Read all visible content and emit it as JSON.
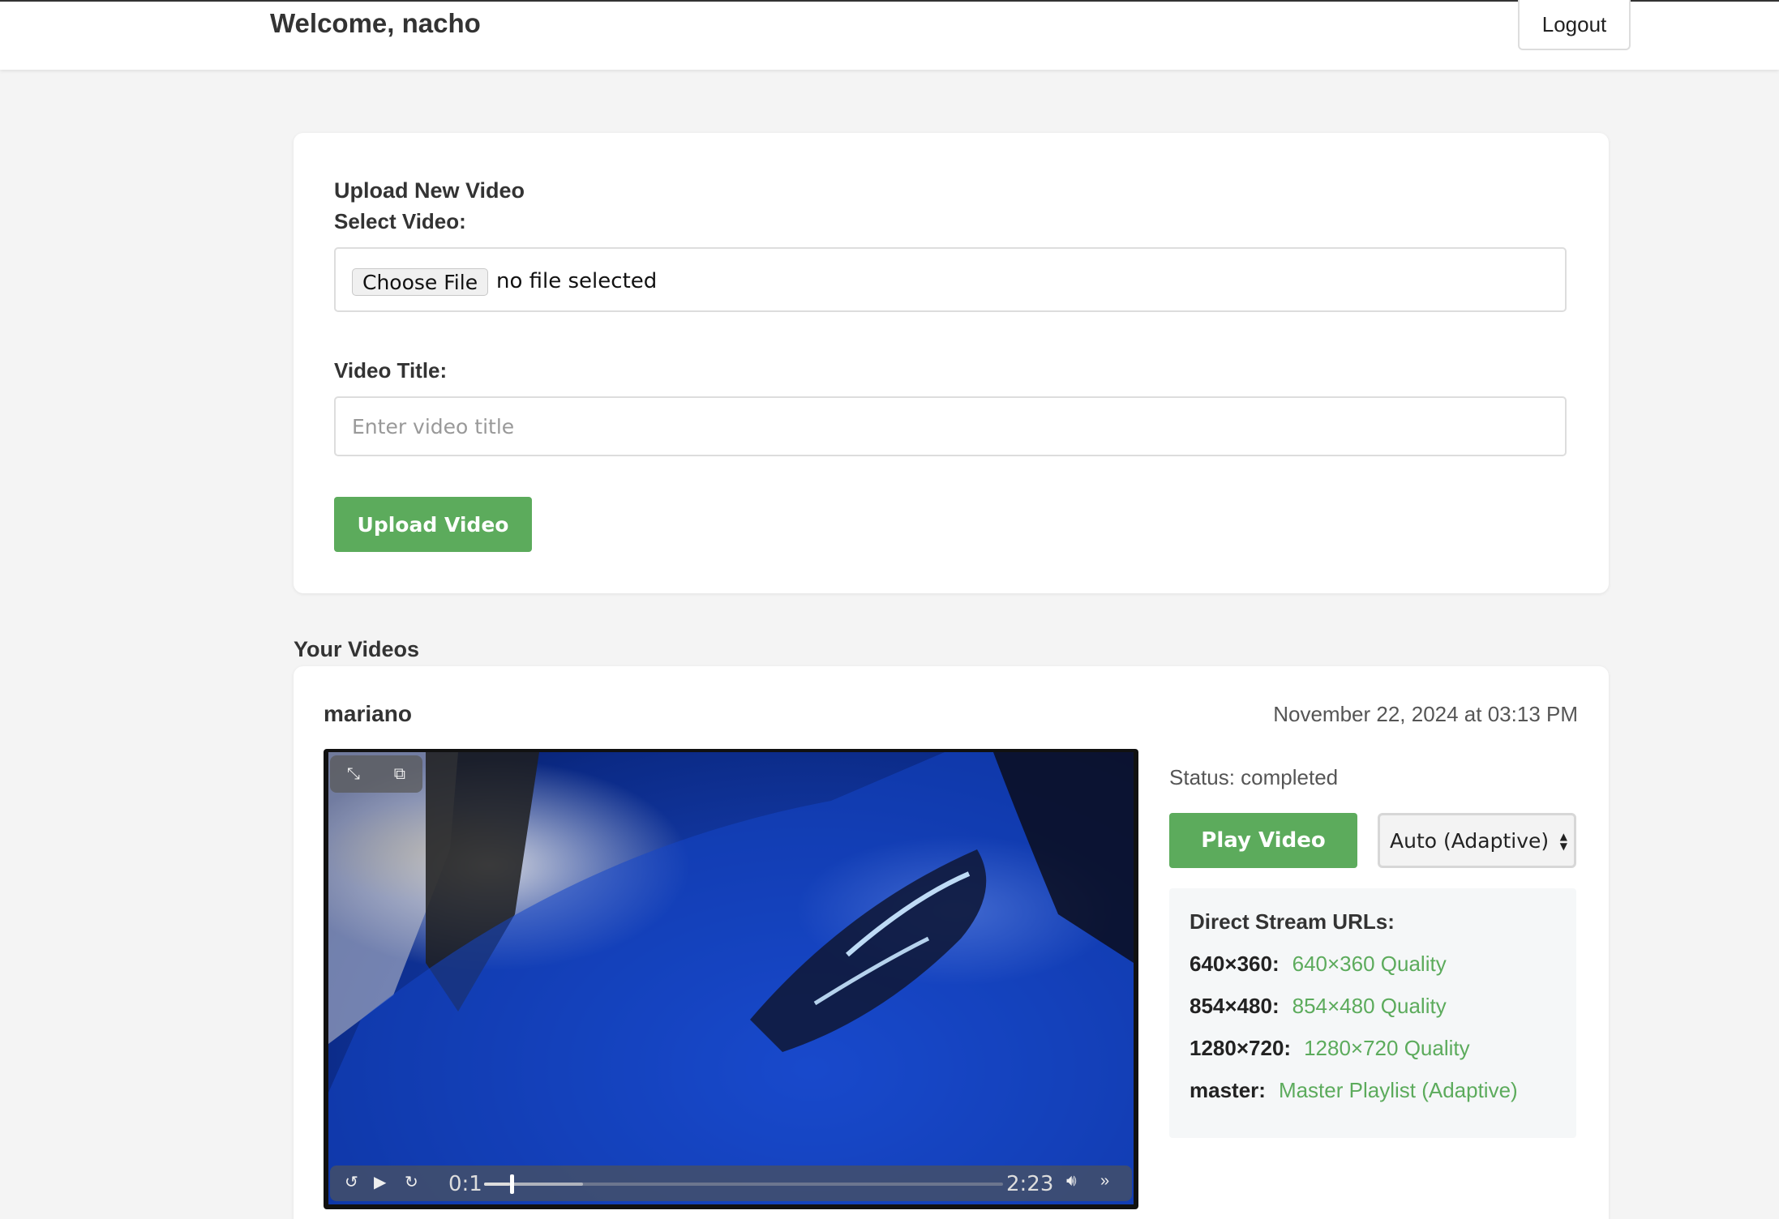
{
  "header": {
    "welcome_text": "Welcome, nacho",
    "logout_label": "Logout"
  },
  "upload": {
    "section_title": "Upload New Video",
    "select_label": "Select Video:",
    "choose_file_label": "Choose File",
    "no_file_text": "no file selected",
    "title_label": "Video Title:",
    "title_placeholder": "Enter video title",
    "title_value": "",
    "upload_button": "Upload Video"
  },
  "videos": {
    "section_title": "Your Videos",
    "items": [
      {
        "name": "mariano",
        "date": "November 22, 2024 at 03:13 PM",
        "status": "Status: completed",
        "play_button": "Play Video",
        "quality_selected": "Auto (Adaptive)",
        "player": {
          "current_time": "0:1",
          "total_time": "2:23",
          "progress_fraction": 0.05,
          "buffered_fraction": 0.19
        },
        "stream_urls_title": "Direct Stream URLs:",
        "stream_urls": [
          {
            "key": "640×360:",
            "label": "640×360 Quality"
          },
          {
            "key": "854×480:",
            "label": "854×480 Quality"
          },
          {
            "key": "1280×720:",
            "label": "1280×720 Quality"
          },
          {
            "key": "master:",
            "label": "Master Playlist (Adaptive)"
          }
        ]
      }
    ]
  },
  "colors": {
    "accent_green": "#5cab5c",
    "background": "#f4f4f4"
  }
}
